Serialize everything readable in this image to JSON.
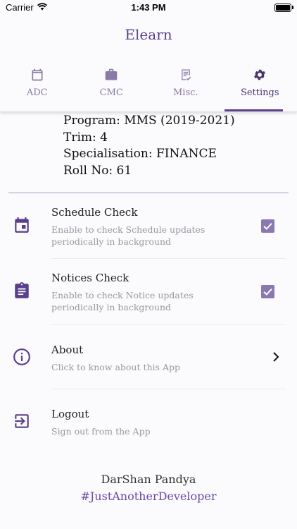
{
  "status": {
    "carrier": "Carrier",
    "time": "1:43 PM"
  },
  "app": {
    "title": "Elearn",
    "accent": "#5b3f8c"
  },
  "tabs": [
    {
      "label": "ADC",
      "icon": "calendar-icon"
    },
    {
      "label": "CMC",
      "icon": "briefcase-icon"
    },
    {
      "label": "Misc.",
      "icon": "checklist-icon"
    },
    {
      "label": "Settings",
      "icon": "gear-icon",
      "active": true
    }
  ],
  "profile": {
    "program": "Program: MMS (2019-2021)",
    "trim": "Trim: 4",
    "specialisation": "Specialisation: FINANCE",
    "roll": "Roll No: 61"
  },
  "settings": {
    "schedule": {
      "title": "Schedule Check",
      "subtitle": "Enable to check Schedule updates periodically in background",
      "checked": true
    },
    "notices": {
      "title": "Notices Check",
      "subtitle": "Enable to check Notice updates periodically in background",
      "checked": true
    },
    "about": {
      "title": "About",
      "subtitle": "Click to know about this App"
    },
    "logout": {
      "title": "Logout",
      "subtitle": "Sign out from the App"
    }
  },
  "footer": {
    "name": "DarShan Pandya",
    "tag": "#JustAnotherDeveloper"
  }
}
